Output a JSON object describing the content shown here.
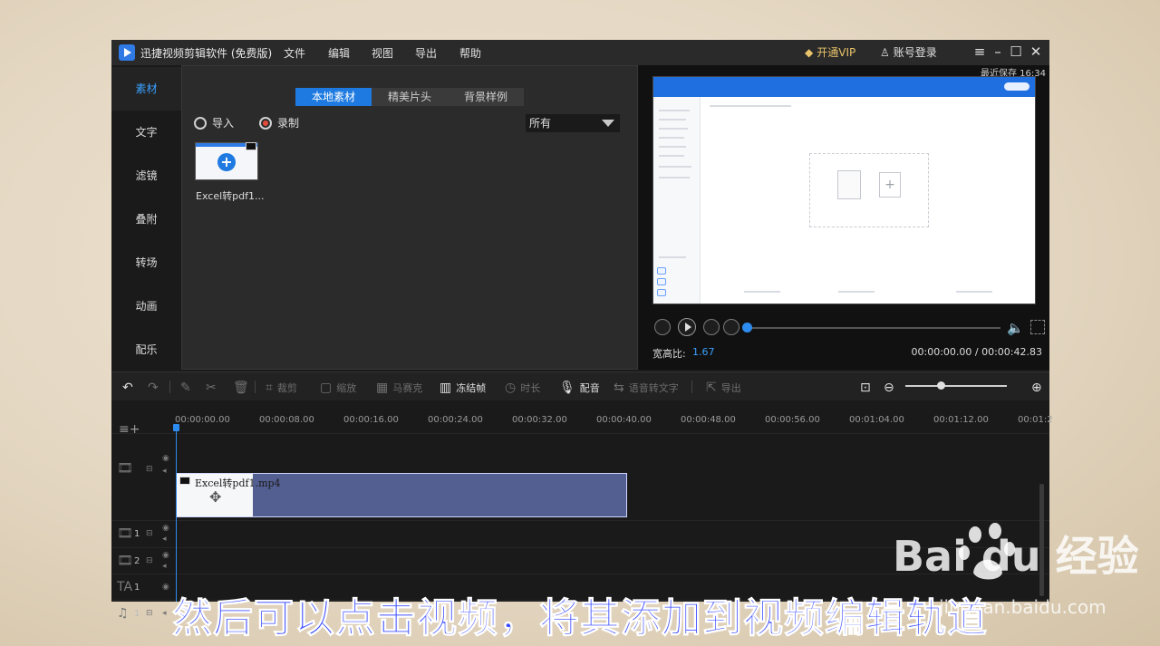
{
  "app": {
    "title": "迅捷视频剪辑软件 (免费版)",
    "menus": [
      "文件",
      "编辑",
      "视图",
      "导出",
      "帮助"
    ],
    "vip_label": "开通VIP",
    "login_label": "账号登录"
  },
  "sidebar": {
    "items": [
      {
        "label": "素材",
        "active": true
      },
      {
        "label": "文字"
      },
      {
        "label": "滤镜"
      },
      {
        "label": "叠附"
      },
      {
        "label": "转场"
      },
      {
        "label": "动画"
      },
      {
        "label": "配乐"
      }
    ]
  },
  "media": {
    "tabs": [
      {
        "label": "本地素材",
        "active": true
      },
      {
        "label": "精美片头"
      },
      {
        "label": "背景样例"
      }
    ],
    "import_label": "导入",
    "record_label": "录制",
    "filter_value": "所有",
    "items": [
      {
        "name": "Excel转pdf1..."
      }
    ]
  },
  "preview": {
    "autosave": "最近保存 16:34",
    "ratio_label": "宽高比:",
    "ratio_value": "1.67",
    "timecode": "00:00:00.00 / 00:00:42.83",
    "progress": 0
  },
  "toolbar": {
    "items": [
      {
        "label": "裁剪",
        "enabled": false
      },
      {
        "label": "缩放",
        "enabled": false
      },
      {
        "label": "马赛克",
        "enabled": false
      },
      {
        "label": "冻结帧",
        "enabled": true
      },
      {
        "label": "时长",
        "enabled": false
      },
      {
        "label": "配音",
        "enabled": true
      },
      {
        "label": "语音转文字",
        "enabled": false
      },
      {
        "label": "导出",
        "enabled": false
      }
    ]
  },
  "timeline": {
    "ruler": [
      "00:00:00.00",
      "00:00:08.00",
      "00:00:16.00",
      "00:00:24.00",
      "00:00:32.00",
      "00:00:40.00",
      "00:00:48.00",
      "00:00:56.00",
      "00:01:04.00",
      "00:01:12.00",
      "00:01:2"
    ],
    "clip_name": "Excel转pdf1.mp4",
    "track_numbers": [
      "1",
      "2",
      "1",
      "1"
    ]
  },
  "overlay": {
    "subtitle": "然后可以点击视频，将其添加到视频编辑轨道",
    "watermark": "Bai du 经验",
    "watermark_url": "jingyan.baidu.com"
  },
  "colors": {
    "accent": "#1e7ae0",
    "clip": "#535e91",
    "subtitle": "#3a4bff"
  }
}
